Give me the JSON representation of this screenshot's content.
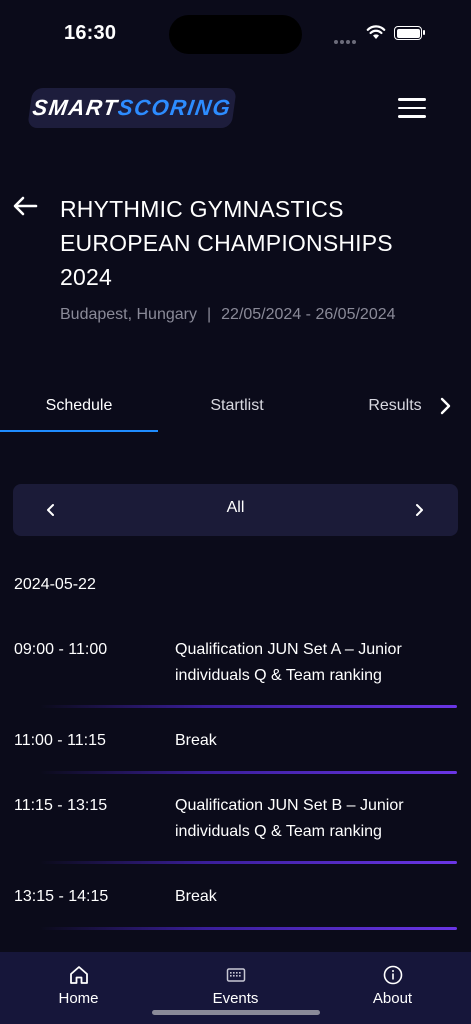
{
  "status_bar": {
    "time": "16:30"
  },
  "header": {
    "logo": {
      "part1": "SMART",
      "part2": "SCORING"
    },
    "menu_icon": "hamburger-icon"
  },
  "event": {
    "title": "RHYTHMIC GYMNASTICS EUROPEAN CHAMPIONSHIPS 2024",
    "location": "Budapest, Hungary",
    "separator": "|",
    "dates": "22/05/2024 - 26/05/2024"
  },
  "tabs": [
    {
      "label": "Schedule",
      "active": true
    },
    {
      "label": "Startlist",
      "active": false
    },
    {
      "label": "Results",
      "active": false
    }
  ],
  "filter": {
    "label": "All"
  },
  "schedule": {
    "date": "2024-05-22",
    "rows": [
      {
        "time": "09:00 - 11:00",
        "desc": "Qualification JUN Set A – Junior individuals Q & Team ranking"
      },
      {
        "time": "11:00 - 11:15",
        "desc": "Break"
      },
      {
        "time": "11:15 - 13:15",
        "desc": "Qualification JUN Set B – Junior individuals Q & Team ranking"
      },
      {
        "time": "13:15 - 14:15",
        "desc": "Break"
      }
    ]
  },
  "bottom_nav": [
    {
      "label": "Home",
      "icon": "home-icon"
    },
    {
      "label": "Events",
      "icon": "events-icon"
    },
    {
      "label": "About",
      "icon": "info-icon"
    }
  ],
  "colors": {
    "background": "#0b0b1a",
    "accent": "#1f8cff",
    "card": "#1b1b38",
    "nav": "#16163a",
    "divider": "#6a35e6"
  }
}
